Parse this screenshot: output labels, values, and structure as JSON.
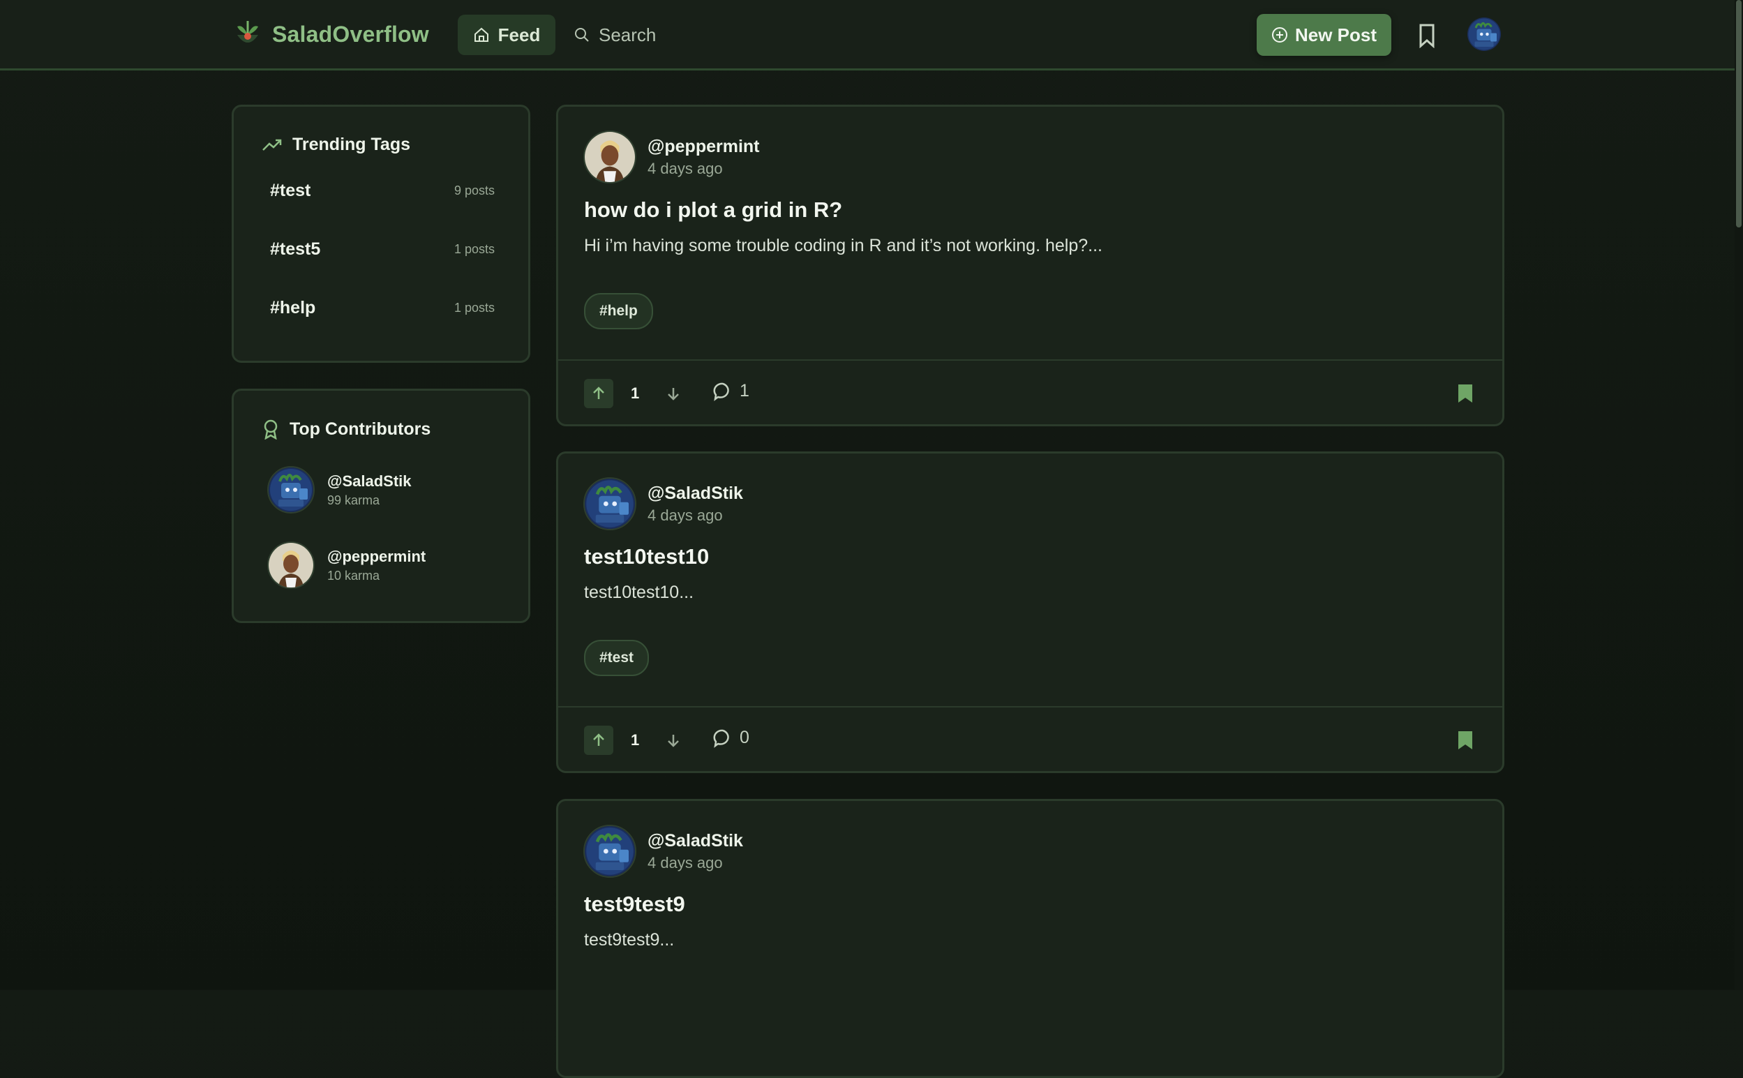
{
  "brand": {
    "name": "SaladOverflow"
  },
  "nav": {
    "feed_label": "Feed",
    "search_label": "Search",
    "new_post_label": "New Post"
  },
  "sidebar": {
    "trending_title": "Trending Tags",
    "tags": [
      {
        "name": "#test",
        "count": "9 posts"
      },
      {
        "name": "#test5",
        "count": "1 posts"
      },
      {
        "name": "#help",
        "count": "1 posts"
      }
    ],
    "contributors_title": "Top Contributors",
    "contributors": [
      {
        "name": "@SaladStik",
        "karma": "99 karma",
        "avatar": "robot-avatar"
      },
      {
        "name": "@peppermint",
        "karma": "10 karma",
        "avatar": "person-avatar"
      }
    ]
  },
  "posts": [
    {
      "author": "@peppermint",
      "time": "4 days ago",
      "title": "how do i plot a grid in R?",
      "body": "Hi i’m having some trouble coding in R and it’s not working. help?...",
      "tag": "#help",
      "votes": "1",
      "comments": "1",
      "avatar": "person-avatar"
    },
    {
      "author": "@SaladStik",
      "time": "4 days ago",
      "title": "test10test10",
      "body": "test10test10...",
      "tag": "#test",
      "votes": "1",
      "comments": "0",
      "avatar": "robot-avatar"
    },
    {
      "author": "@SaladStik",
      "time": "4 days ago",
      "title": "test9test9",
      "body": "test9test9...",
      "avatar": "robot-avatar"
    }
  ],
  "colors": {
    "accent": "#4d7a4a",
    "brand_text": "#8fbf86",
    "background": "#141b14",
    "card": "#1a231a"
  }
}
